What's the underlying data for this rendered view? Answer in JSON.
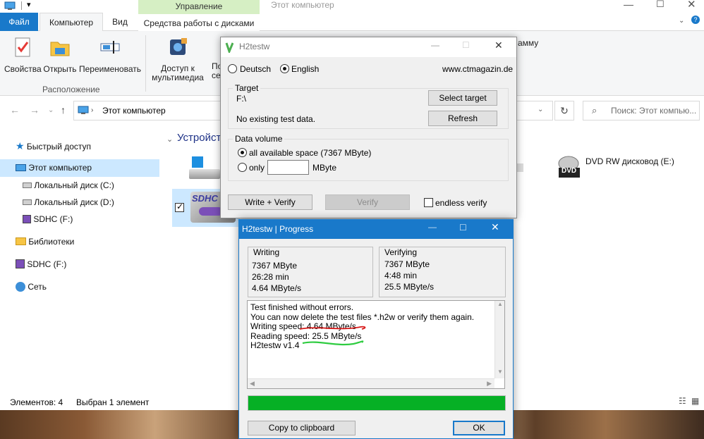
{
  "explorer": {
    "tabs": {
      "file": "Файл",
      "computer": "Компьютер",
      "view": "Вид",
      "disk_tools": "Средства работы с дисками"
    },
    "manage_header": "Управление",
    "ribbon": {
      "properties": "Свойства",
      "open": "Открыть",
      "rename": "Переименовать",
      "media_access_line1": "Доступ к",
      "media_access_line2": "мультимедиа",
      "cut_fragment_1": "По",
      "cut_fragment_2": "сет",
      "cut_fragment_3": "амму",
      "group_location": "Расположение"
    },
    "address": "Этот компьютер",
    "search_placeholder": "Поиск: Этот компью...",
    "nav": {
      "quick_access": "Быстрый доступ",
      "this_pc": "Этот компьютер",
      "disk_c": "Локальный диск (C:)",
      "disk_d": "Локальный диск (D:)",
      "sdhc_f": "SDHC (F:)",
      "libraries": "Библиотеки",
      "sdhc_f2": "SDHC (F:)",
      "network": "Сеть"
    },
    "devices_heading": "Устройст",
    "dvd_label": "DVD RW дисковод (E:)",
    "dvd_badge": "DVD",
    "sd_label": "SDHC",
    "status": {
      "items": "Элементов: 4",
      "selected": "Выбран 1 элемент"
    }
  },
  "h2testw": {
    "title": "H2testw",
    "lang_de": "Deutsch",
    "lang_en": "English",
    "url": "www.ctmagazin.de",
    "target_caption": "Target",
    "target_path": "F:\\",
    "target_status": "No existing test data.",
    "select_target": "Select target",
    "refresh": "Refresh",
    "volume_caption": "Data volume",
    "all_space": "all available space (7367 MByte)",
    "only": "only",
    "mbyte_unit": "MByte",
    "write_verify": "Write + Verify",
    "verify": "Verify",
    "endless_verify": "endless verify"
  },
  "progress": {
    "title": "H2testw | Progress",
    "writing": {
      "caption": "Writing",
      "size": "7367 MByte",
      "time": "26:28 min",
      "speed": "4.64 MByte/s"
    },
    "verifying": {
      "caption": "Verifying",
      "size": "7367 MByte",
      "time": "4:48 min",
      "speed": "25.5 MByte/s"
    },
    "result_lines": [
      "Test finished without errors.",
      "You can now delete the test files *.h2w or verify them again.",
      "Writing speed: 4.64 MByte/s",
      "Reading speed: 25.5 MByte/s",
      "H2testw v1.4"
    ],
    "progress_fraction": 1.0,
    "copy_clipboard": "Copy to clipboard",
    "ok": "OK"
  },
  "colors": {
    "accent": "#1979ca",
    "progress": "#06b025",
    "selection": "#cce8ff"
  }
}
